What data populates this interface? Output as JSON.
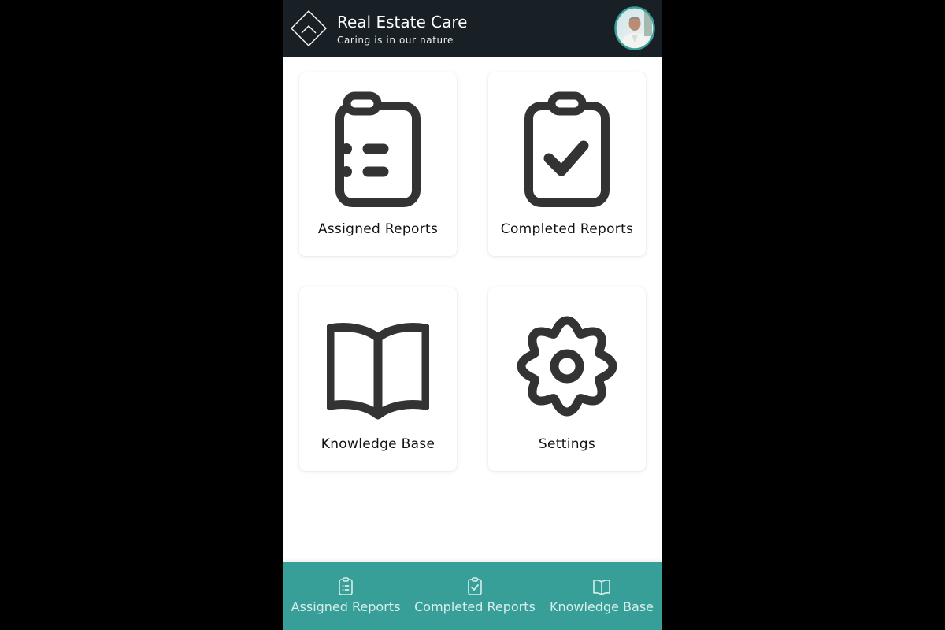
{
  "header": {
    "title": "Real Estate Care",
    "tagline": "Caring is in our nature",
    "background_color": "#182026",
    "logo_icon": "diamond-house-logo",
    "avatar_icon": "user-avatar"
  },
  "dashboard": {
    "tiles": [
      {
        "label": "Assigned Reports",
        "icon": "clipboard-list-icon"
      },
      {
        "label": "Completed Reports",
        "icon": "clipboard-check-icon"
      },
      {
        "label": "Knowledge Base",
        "icon": "book-open-icon"
      },
      {
        "label": "Settings",
        "icon": "gear-icon"
      }
    ]
  },
  "bottom_nav": {
    "background_color": "#389f98",
    "items": [
      {
        "label": "Assigned Reports",
        "icon": "clipboard-list-icon"
      },
      {
        "label": "Completed Reports",
        "icon": "clipboard-check-icon"
      },
      {
        "label": "Knowledge Base",
        "icon": "book-open-icon"
      }
    ]
  }
}
